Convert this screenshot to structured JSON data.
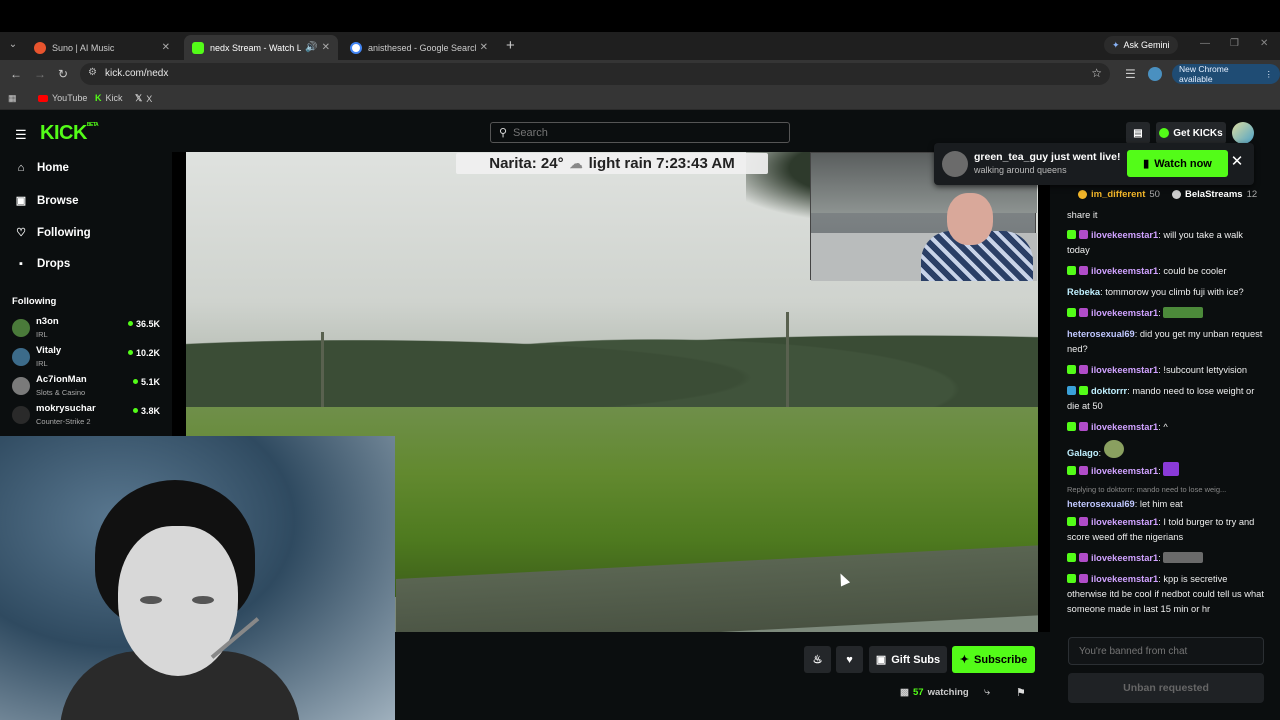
{
  "browser": {
    "tabs": [
      {
        "label": "Suno | AI Music",
        "color": "#e8542e"
      },
      {
        "label": "nedx Stream - Watch Live o",
        "color": "#53fc18"
      },
      {
        "label": "anisthesed - Google Search",
        "color": "#4285f4"
      }
    ],
    "gemini_label": "Ask Gemini",
    "url": "kick.com/nedx",
    "new_chrome_label": "New Chrome available",
    "bookmarks": [
      "YouTube",
      "Kick",
      "X"
    ]
  },
  "kick": {
    "logo": "KICK",
    "logo_beta": "BETA",
    "search_placeholder": "Search",
    "get_kicks_label": "Get KICKs",
    "nav": [
      "Home",
      "Browse",
      "Following",
      "Drops"
    ],
    "following_label": "Following",
    "following": [
      {
        "name": "n3on",
        "category": "IRL",
        "viewers": "36.5K",
        "color": "#4a7a3a"
      },
      {
        "name": "Vitaly",
        "category": "IRL",
        "viewers": "10.2K",
        "color": "#3c6b8a"
      },
      {
        "name": "Ac7ionMan",
        "category": "Slots & Casino",
        "viewers": "5.1K",
        "color": "#7a7a7a"
      },
      {
        "name": "mokrysuchar",
        "category": "Counter-Strike 2",
        "viewers": "3.8K",
        "color": "#2a2a2a"
      }
    ]
  },
  "stream": {
    "weather_location": "Narita: 24°",
    "weather_text": "light rain 7:23:43 AM",
    "gift_subs_label": "Gift Subs",
    "subscribe_label": "Subscribe",
    "viewers_count": "57",
    "viewers_label": "watching"
  },
  "notification": {
    "title": "green_tea_guy just went live!",
    "subtitle": "walking around queens",
    "watch_label": "Watch now"
  },
  "chat": {
    "top_gifters": [
      {
        "name": "im_different",
        "count": "50"
      },
      {
        "name": "BelaStreams",
        "count": "12"
      }
    ],
    "messages": [
      {
        "user": "",
        "text": "share it",
        "color": "#ffffff"
      },
      {
        "user": "ilovekeemstar1",
        "text": "will you take a walk today",
        "color": "#d0a2ff"
      },
      {
        "user": "ilovekeemstar1",
        "text": "could be cooler",
        "color": "#d0a2ff"
      },
      {
        "user": "Rebeka",
        "text": "tommorow you climb fuji with ice?",
        "color": "#c0f0ff"
      },
      {
        "user": "ilovekeemstar1",
        "text": "",
        "color": "#d0a2ff"
      },
      {
        "user": "heterosexual69",
        "text": "did you get my unban request ned?",
        "color": "#c0c8ff"
      },
      {
        "user": "ilovekeemstar1",
        "text": "!subcount lettyvision",
        "color": "#d0a2ff"
      },
      {
        "user": "doktorrr",
        "text": "mando need to lose weight or die at 50",
        "color": "#c0f0ff"
      },
      {
        "user": "ilovekeemstar1",
        "text": "^",
        "color": "#d0a2ff"
      },
      {
        "user": "Galago",
        "text": "",
        "color": "#c0f0ff"
      },
      {
        "user": "ilovekeemstar1",
        "text": "",
        "color": "#d0a2ff"
      },
      {
        "user": "heterosexual69",
        "text": "let him eat",
        "color": "#c0c8ff",
        "reply": "Replying to doktorrr: mando need to lose weig..."
      },
      {
        "user": "ilovekeemstar1",
        "text": "I told burger to try and score weed off the nigerians",
        "color": "#d0a2ff"
      },
      {
        "user": "ilovekeemstar1",
        "text": "",
        "color": "#d0a2ff"
      },
      {
        "user": "ilovekeemstar1",
        "text": "kpp is secretive otherwise itd be cool if nedbot could tell us what someone made in last 15 min or hr",
        "color": "#d0a2ff"
      }
    ],
    "input_placeholder": "You're banned from chat",
    "unban_label": "Unban requested"
  }
}
